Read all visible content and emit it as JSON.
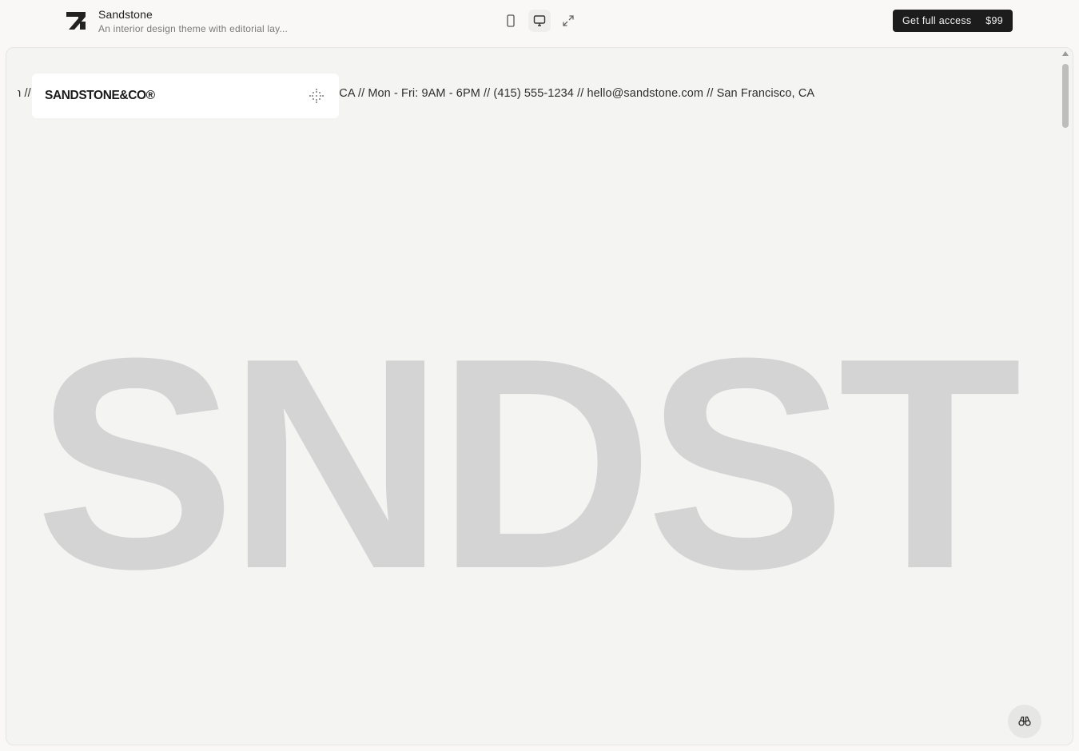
{
  "topbar": {
    "title": "Sandstone",
    "description": "An interior design theme with editorial lay...",
    "devices": [
      {
        "name": "mobile",
        "icon": "mobile-icon",
        "active": false
      },
      {
        "name": "desktop",
        "icon": "desktop-icon",
        "active": true
      },
      {
        "name": "fullscreen",
        "icon": "expand-icon",
        "active": false
      }
    ],
    "cta_label": "Get full access",
    "cta_price": "$99"
  },
  "site": {
    "logo": "SANDSTONE&CO®",
    "menu_icon": "dotted-grid-icon",
    "ticker": "om // (415) 555-1234 // hello@sandstone.com // San Francisco, CA // Mon - Fri: 9AM - 6PM // (415) 555-1234 // hello@sandstone.com // San Francisco, CA",
    "hero_word": "SNDST",
    "floating_button_icon": "binoculars-icon"
  },
  "colors": {
    "accent": "#1c1c1c",
    "hero_text": "#d4d4d4",
    "frame_bg": "#f4f4f3"
  }
}
